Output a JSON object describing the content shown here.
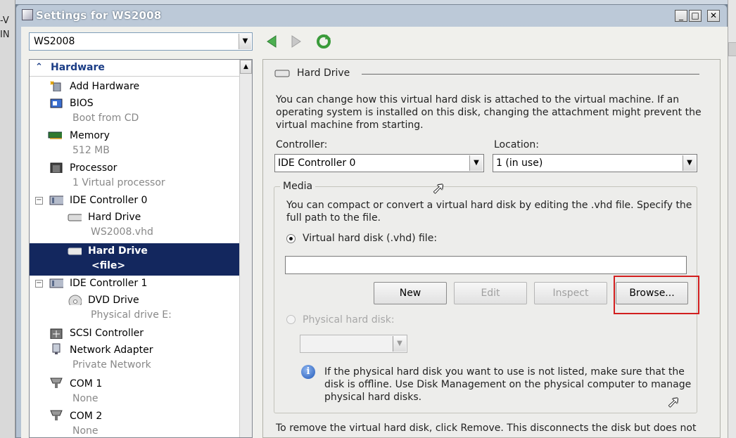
{
  "outer": {
    "left_labels": [
      "-V",
      "IN"
    ]
  },
  "window": {
    "title": "Settings for WS2008",
    "controls": {
      "minimize": "_",
      "maximize": "□",
      "close": "✕"
    }
  },
  "vm_selector": {
    "value": "WS2008"
  },
  "toolbar": {
    "back_icon": "left-arrow",
    "forward_icon": "right-arrow",
    "refresh_icon": "refresh"
  },
  "tree": {
    "section": "Hardware",
    "items": [
      {
        "label": "Add Hardware",
        "sub": ""
      },
      {
        "label": "BIOS",
        "sub": "Boot from CD"
      },
      {
        "label": "Memory",
        "sub": "512 MB"
      },
      {
        "label": "Processor",
        "sub": "1 Virtual processor"
      },
      {
        "label": "IDE Controller 0",
        "sub": "",
        "expander": "⊟"
      },
      {
        "label": "Hard Drive",
        "sub": "WS2008.vhd"
      },
      {
        "label": "Hard Drive",
        "sub": "<file>"
      },
      {
        "label": "IDE Controller 1",
        "sub": "",
        "expander": "⊟"
      },
      {
        "label": "DVD Drive",
        "sub": "Physical drive E:"
      },
      {
        "label": "SCSI Controller",
        "sub": ""
      },
      {
        "label": "Network Adapter",
        "sub": "Private Network"
      },
      {
        "label": "COM 1",
        "sub": "None"
      },
      {
        "label": "COM 2",
        "sub": "None"
      }
    ]
  },
  "panel": {
    "header": "Hard Drive",
    "description": [
      "You can change how this virtual hard disk is attached to the virtual machine. If an",
      "operating system is installed on this disk, changing the attachment might prevent the",
      "virtual machine from starting."
    ],
    "controller_label": "Controller:",
    "controller_value": "IDE Controller 0",
    "location_label": "Location:",
    "location_value": "1 (in use)",
    "media": {
      "legend": "Media",
      "description": [
        "You can compact or convert a virtual hard disk by editing the .vhd file. Specify the",
        "full path to the file."
      ],
      "vhd_radio_label": "Virtual hard disk (.vhd) file:",
      "vhd_path_value": "",
      "buttons": {
        "new": "New",
        "edit": "Edit",
        "inspect": "Inspect",
        "browse": "Browse..."
      },
      "physical_radio_label": "Physical hard disk:",
      "physical_value": "",
      "info": [
        "If the physical hard disk you want to use is not listed, make sure that the",
        "disk is offline. Use Disk Management on the physical computer to manage",
        "physical hard disks."
      ]
    },
    "remove_text": "To remove the virtual hard disk, click Remove. This disconnects the disk but does not"
  },
  "colors": {
    "selection": "#13275e",
    "highlight": "#d21f1f",
    "hardware_header": "#1b3d86"
  }
}
